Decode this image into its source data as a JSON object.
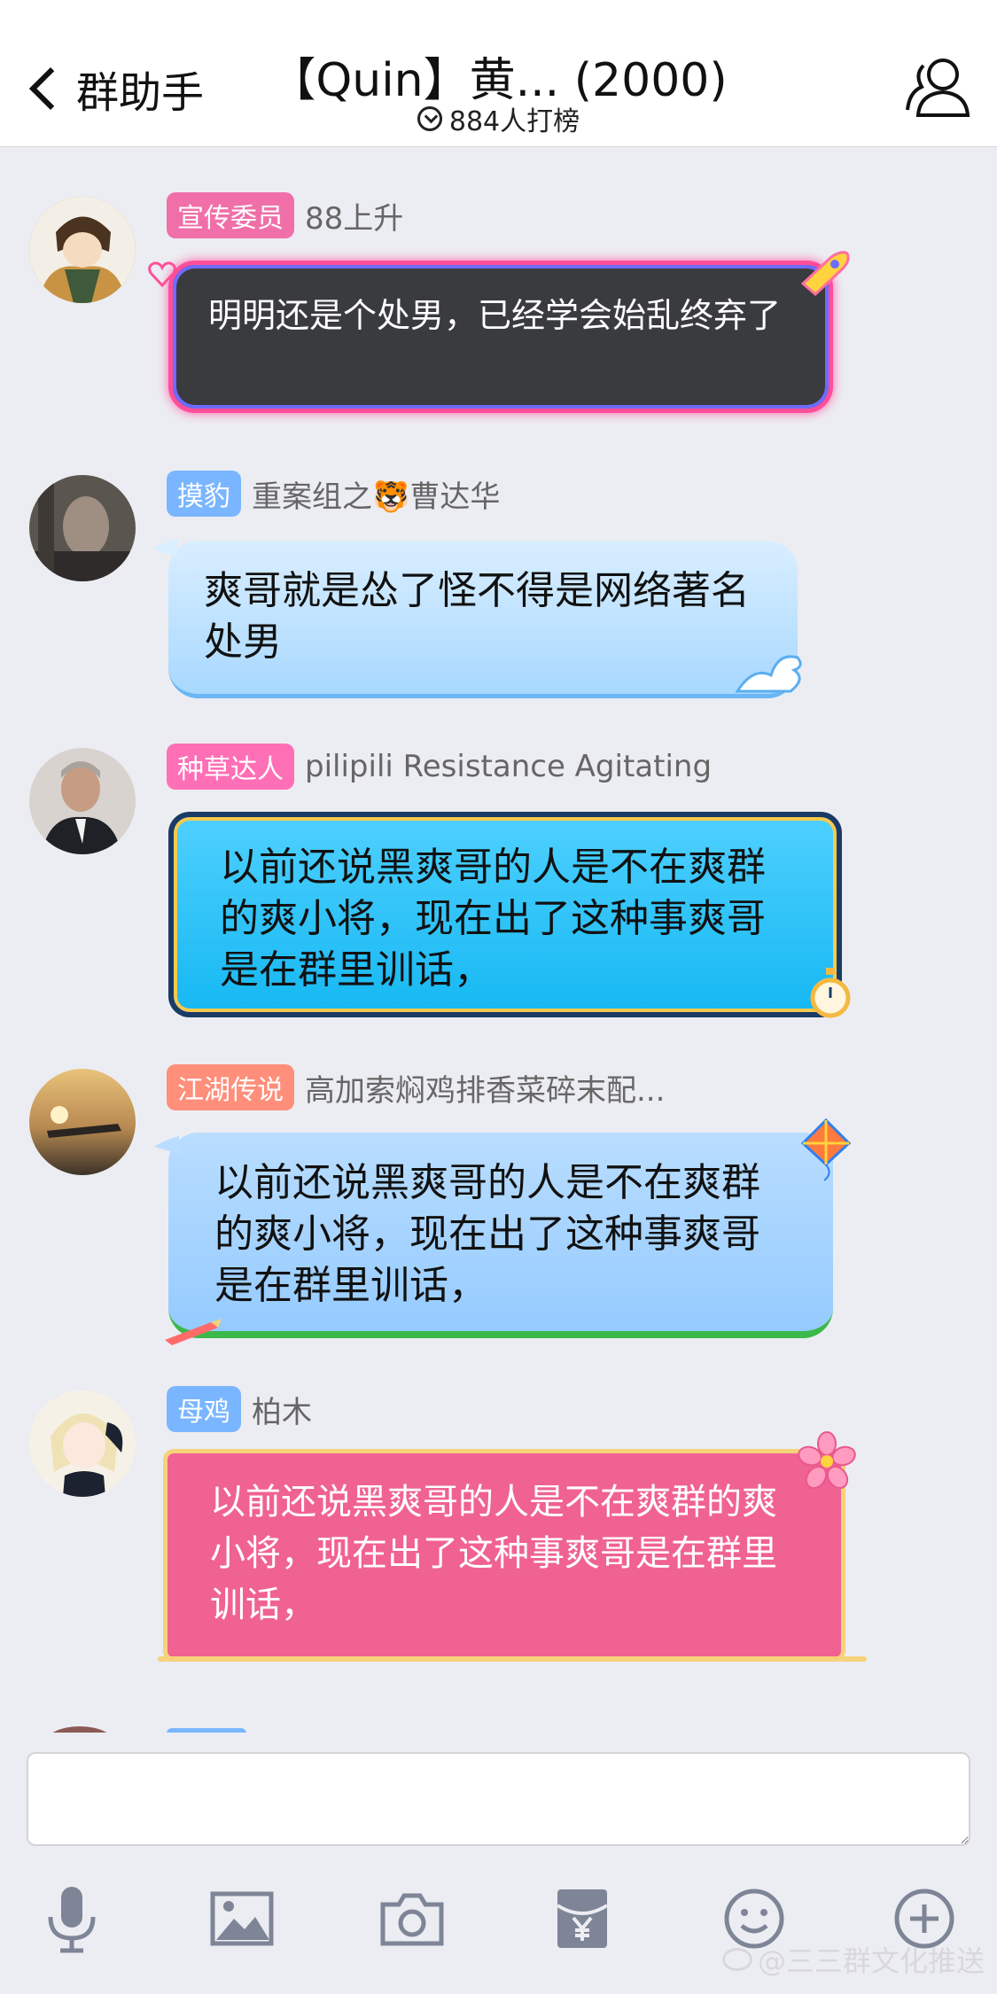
{
  "header": {
    "back_label": "群助手",
    "title": "【Quin】黄... (2000)",
    "subtitle": "884人打榜"
  },
  "messages": [
    {
      "badge": "宣传委员",
      "badge_color": "#f06fa8",
      "nickname": "88上升",
      "text": "明明还是个处男，已经学会始乱终弃了"
    },
    {
      "badge": "摸豹",
      "badge_color": "#7ab6ff",
      "nickname": "重案组之🐯曹达华",
      "text": "爽哥就是怂了怪不得是网络著名处男"
    },
    {
      "badge": "种草达人",
      "badge_color": "#ff6fb6",
      "nickname": "pilipili Resistance Agitating",
      "text": "以前还说黑爽哥的人是不在爽群的爽小将，现在出了这种事爽哥是在群里训话，"
    },
    {
      "badge": "江湖传说",
      "badge_color": "#ff8e7a",
      "nickname": "高加索焖鸡排香菜碎末配...",
      "text": "以前还说黑爽哥的人是不在爽群的爽小将，现在出了这种事爽哥是在群里训话，"
    },
    {
      "badge": "母鸡",
      "badge_color": "#7ab6ff",
      "nickname": "柏木",
      "text": "以前还说黑爽哥的人是不在爽群的爽小将，现在出了这种事爽哥是在群里训话，"
    }
  ],
  "input": {
    "placeholder": ""
  },
  "watermark": "@三三群文化推送",
  "colors": {
    "header_bg": "#ffffff",
    "chat_bg": "#ecedf2"
  }
}
